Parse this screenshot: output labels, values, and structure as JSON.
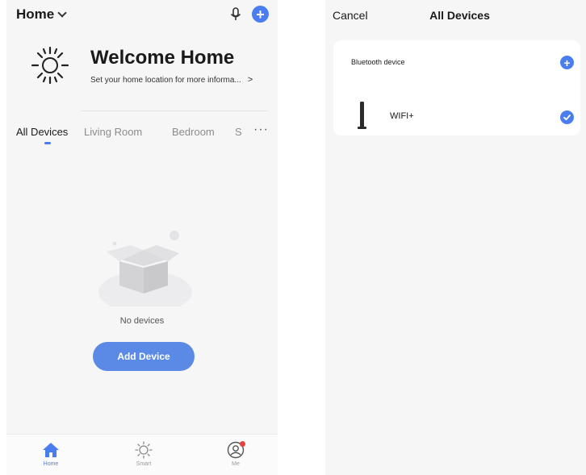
{
  "left_screen": {
    "header": {
      "home_label": "Home"
    },
    "welcome": {
      "title": "Welcome Home",
      "subtitle": "Set your home location for more informa...",
      "arrow": ">"
    },
    "tabs": [
      {
        "label": "All Devices",
        "active": true
      },
      {
        "label": "Living Room",
        "active": false
      },
      {
        "label": "Bedroom",
        "active": false
      },
      {
        "label": "S",
        "active": false
      }
    ],
    "more_label": "···",
    "empty_state": {
      "message": "No devices",
      "button_label": "Add Device"
    },
    "bottom_nav": [
      {
        "label": "Home",
        "icon": "home-icon",
        "active": true
      },
      {
        "label": "Smart",
        "icon": "sun-icon",
        "active": false
      },
      {
        "label": "Me",
        "icon": "profile-icon",
        "active": false
      }
    ]
  },
  "right_screen": {
    "header": {
      "cancel_label": "Cancel",
      "title": "All Devices"
    },
    "card": {
      "bluetooth_label": "Bluetooth device",
      "devices": [
        {
          "name": "WIFI+",
          "selected": true
        }
      ]
    }
  },
  "colors": {
    "accent": "#4a7ef0",
    "button": "#5b8ae6",
    "badge": "#e8423a",
    "background": "#f6f6f7"
  }
}
